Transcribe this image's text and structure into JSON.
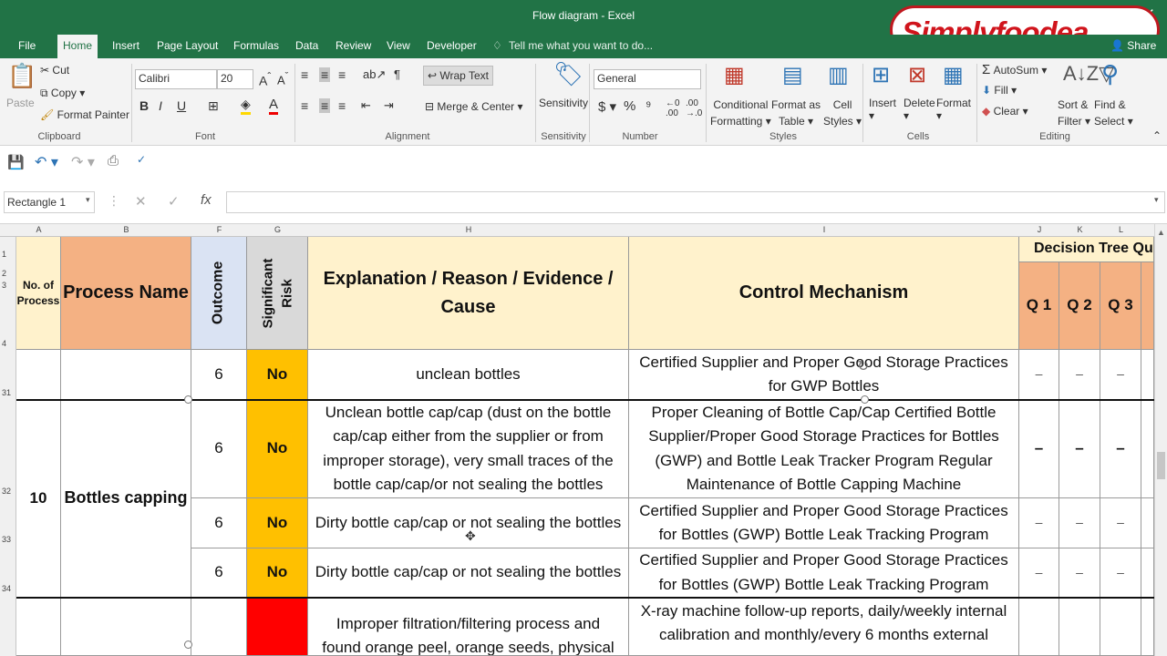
{
  "window": {
    "title": "Flow diagram - Excel",
    "brand": "Simplyfoodea",
    "share": "Share"
  },
  "menu": [
    "File",
    "Home",
    "Insert",
    "Page Layout",
    "Formulas",
    "Data",
    "Review",
    "View",
    "Developer"
  ],
  "tell_me": "Tell me what you want to do...",
  "ribbon": {
    "clipboard": {
      "paste": "Paste",
      "cut": "Cut",
      "copy": "Copy",
      "format_painter": "Format Painter",
      "group": "Clipboard"
    },
    "font": {
      "name": "Calibri",
      "size": "20",
      "group": "Font"
    },
    "alignment": {
      "wrap": "Wrap Text",
      "merge": "Merge & Center",
      "group": "Alignment"
    },
    "sensitivity": {
      "label": "Sensitivity",
      "group": "Sensitivity"
    },
    "number": {
      "format": "General",
      "group": "Number"
    },
    "styles": {
      "cond1": "Conditional",
      "cond2": "Formatting",
      "fmt1": "Format as",
      "fmt2": "Table",
      "cell1": "Cell",
      "cell2": "Styles",
      "group": "Styles"
    },
    "cells": {
      "insert": "Insert",
      "delete": "Delete",
      "format": "Format",
      "group": "Cells"
    },
    "editing": {
      "autosum": "AutoSum",
      "fill": "Fill",
      "clear": "Clear",
      "sort1": "Sort &",
      "sort2": "Filter",
      "find1": "Find &",
      "find2": "Select",
      "group": "Editing"
    }
  },
  "name_box": "Rectangle 1",
  "formula": "",
  "columns": {
    "A": "A",
    "B": "B",
    "F": "F",
    "G": "G",
    "H": "H",
    "I": "I",
    "J": "J",
    "K": "K",
    "L": "L"
  },
  "rows": {
    "r1": "1",
    "r2": "2",
    "r3": "3",
    "r4": "4",
    "r31": "31",
    "r32": "32",
    "r33": "33",
    "r34": "34"
  },
  "header": {
    "no_process": "No. of Process",
    "process_name": "Process Name",
    "outcome": "Outcome",
    "significant_risk": "Significant Risk",
    "explanation": "Explanation / Reason / Evidence / Cause",
    "control": "Control Mechanism",
    "decision_tree": "Decision Tree Qu",
    "q1": "Q 1",
    "q2": "Q 2",
    "q3": "Q 3"
  },
  "process": {
    "number": "10",
    "name": "Bottles capping"
  },
  "rows_data": [
    {
      "outcome": "6",
      "risk": "No",
      "explanation": "unclean bottles",
      "control": "Certified Supplier and Proper Good Storage Practices for GWP Bottles",
      "q": [
        "–",
        "–",
        "–"
      ]
    },
    {
      "outcome": "6",
      "risk": "No",
      "explanation": "Unclean bottle cap/cap (dust on the bottle cap/cap either from the supplier or from improper storage), very small traces of the bottle cap/cap/or not sealing the bottles",
      "control": "Proper Cleaning of Bottle Cap/Cap Certified Bottle Supplier/Proper Good Storage Practices for Bottles (GWP) and Bottle Leak Tracker Program Regular Maintenance of Bottle Capping Machine",
      "q": [
        "–",
        "–",
        "–"
      ]
    },
    {
      "outcome": "6",
      "risk": "No",
      "explanation": "Dirty bottle cap/cap or not sealing the bottles",
      "control": "Certified Supplier and Proper Good Storage Practices for Bottles (GWP) Bottle Leak Tracking Program",
      "q": [
        "–",
        "–",
        "–"
      ]
    },
    {
      "outcome": "6",
      "risk": "No",
      "explanation": "Dirty bottle cap/cap or not sealing the bottles",
      "control": "Certified Supplier and Proper Good Storage Practices for Bottles (GWP) Bottle Leak Tracking Program",
      "q": [
        "–",
        "–",
        "–"
      ]
    },
    {
      "outcome": "",
      "risk": "",
      "explanation": "Improper filtration/filtering process and found orange peel, orange seeds, physical",
      "control": "X-ray machine follow-up reports, daily/weekly internal calibration and monthly/every 6 months external"
    }
  ],
  "colors": {
    "excel_green": "#217346",
    "header_orange": "#f4b183",
    "header_yellow": "#fff2cc",
    "risk_amber": "#ffc000",
    "risk_red": "#ff0000"
  }
}
